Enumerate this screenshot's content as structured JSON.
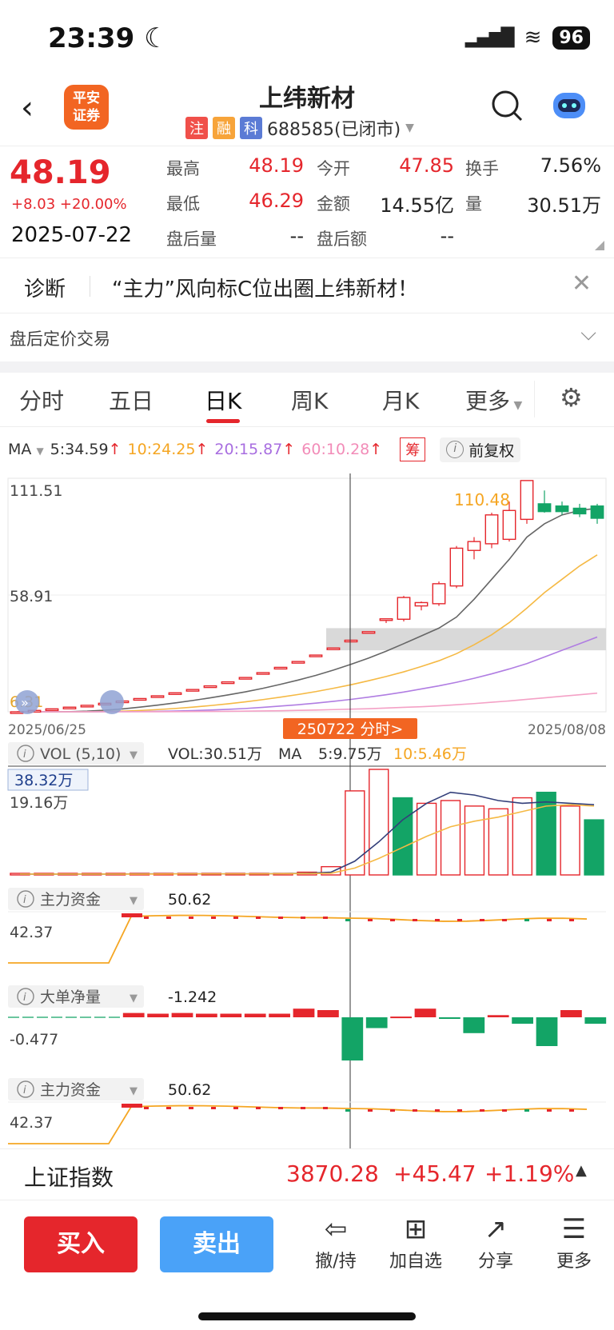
{
  "status": {
    "time": "23:39",
    "battery": "96"
  },
  "header": {
    "logo_line1": "平安",
    "logo_line2": "证券",
    "title": "上纬新材",
    "tags": [
      {
        "label": "注",
        "color": "#f0504a"
      },
      {
        "label": "融",
        "color": "#f7a43a"
      },
      {
        "label": "科",
        "color": "#5b7bd5"
      }
    ],
    "code": "688585(已闭市)"
  },
  "quote": {
    "price": "48.19",
    "change": "+8.03 +20.00%",
    "date": "2025-07-22",
    "fields": [
      {
        "label": "最高",
        "value": "48.19",
        "color": "red"
      },
      {
        "label": "今开",
        "value": "47.85",
        "color": "red"
      },
      {
        "label": "换手",
        "value": "7.56%",
        "color": "black"
      },
      {
        "label": "最低",
        "value": "46.29",
        "color": "red"
      },
      {
        "label": "金额",
        "value": "14.55亿",
        "color": "black"
      },
      {
        "label": "量",
        "value": "30.51万",
        "color": "black"
      },
      {
        "label": "盘后量",
        "value": "--",
        "color": "black"
      },
      {
        "label": "盘后额",
        "value": "--",
        "color": "black"
      }
    ]
  },
  "diagnosis": {
    "label": "诊断",
    "text": "“主力”风向标C位出圈上纬新材！"
  },
  "post_trading": {
    "label": "盘后定价交易"
  },
  "tabs": [
    {
      "label": "分时",
      "active": false
    },
    {
      "label": "五日",
      "active": false
    },
    {
      "label": "日K",
      "active": true
    },
    {
      "label": "周K",
      "active": false
    },
    {
      "label": "月K",
      "active": false
    },
    {
      "label": "更多",
      "active": false
    }
  ],
  "ma": {
    "label": "MA",
    "items": [
      {
        "text": "5:34.59",
        "color": "#333333"
      },
      {
        "text": "10:24.25",
        "color": "#f5a623"
      },
      {
        "text": "20:15.87",
        "color": "#a86ee0"
      },
      {
        "text": "60:10.28",
        "color": "#f28cb8"
      }
    ],
    "chip_label": "筹",
    "fq_label": "前复权"
  },
  "chart_data": {
    "type": "candlestick",
    "y_labels": [
      "111.51",
      "58.91",
      "6.31"
    ],
    "ylim": [
      6.31,
      111.51
    ],
    "x_start": "2025/06/25",
    "x_end": "2025/08/08",
    "max_label": "110.48",
    "crosshair_label": "250722 分时>",
    "candles": [
      [
        6.31,
        6.31,
        6.31,
        6.31
      ],
      [
        6.94,
        6.94,
        6.94,
        6.94
      ],
      [
        7.63,
        7.63,
        7.63,
        7.63
      ],
      [
        8.39,
        8.39,
        8.39,
        8.39
      ],
      [
        9.23,
        9.23,
        9.23,
        9.23
      ],
      [
        10.15,
        10.15,
        10.15,
        10.15
      ],
      [
        11.17,
        11.17,
        11.17,
        11.17
      ],
      [
        12.28,
        12.28,
        12.28,
        12.28
      ],
      [
        13.51,
        13.51,
        13.51,
        13.51
      ],
      [
        14.86,
        14.86,
        14.86,
        14.86
      ],
      [
        16.35,
        16.35,
        16.35,
        16.35
      ],
      [
        17.98,
        17.98,
        17.98,
        17.98
      ],
      [
        19.78,
        19.78,
        19.78,
        19.78
      ],
      [
        21.76,
        21.76,
        21.76,
        21.76
      ],
      [
        23.94,
        23.94,
        23.94,
        23.94
      ],
      [
        26.33,
        26.33,
        26.33,
        26.33
      ],
      [
        28.96,
        28.96,
        28.96,
        28.96
      ],
      [
        31.86,
        31.86,
        31.86,
        31.86
      ],
      [
        35.05,
        35.05,
        35.05,
        35.05
      ],
      [
        38.55,
        38.55,
        38.55,
        38.55
      ],
      [
        42.41,
        42.41,
        42.41,
        42.41
      ],
      [
        47.85,
        48.19,
        46.29,
        48.19
      ],
      [
        48.0,
        58.5,
        47.0,
        57.8
      ],
      [
        54.0,
        56.0,
        52.0,
        55.5
      ],
      [
        55.0,
        65.0,
        54.0,
        64.0
      ],
      [
        63.0,
        81.0,
        62.0,
        80.0
      ],
      [
        79.0,
        85.0,
        75.0,
        83.0
      ],
      [
        82.0,
        96.0,
        80.0,
        95.0
      ],
      [
        84.0,
        101.0,
        83.0,
        97.0
      ],
      [
        93.0,
        110.48,
        91.0,
        110.48
      ],
      [
        100.0,
        106.0,
        96.0,
        96.5
      ],
      [
        99.0,
        101.0,
        95.0,
        96.5
      ],
      [
        98.0,
        100.0,
        94.0,
        95.5
      ],
      [
        99.0,
        100.0,
        91.0,
        93.5
      ]
    ],
    "ma_lines": [
      {
        "name": "MA5",
        "color": "#666666",
        "values": [
          6.31,
          6.31,
          6.31,
          6.4,
          6.6,
          7.0,
          7.6,
          8.4,
          9.3,
          10.3,
          11.4,
          12.6,
          13.9,
          15.3,
          16.9,
          18.7,
          20.6,
          22.7,
          25.1,
          27.7,
          30.5,
          33.6,
          37.0,
          40.5,
          44.0,
          49.0,
          57.0,
          66.0,
          75.0,
          85.0,
          91.0,
          95.0,
          97.0,
          98.0
        ]
      },
      {
        "name": "MA10",
        "color": "#f5b944",
        "values": [
          6.31,
          6.31,
          6.31,
          6.31,
          6.35,
          6.45,
          6.6,
          6.9,
          7.3,
          7.8,
          8.4,
          9.1,
          9.9,
          10.8,
          11.8,
          12.9,
          14.1,
          15.4,
          16.9,
          18.5,
          20.3,
          22.2,
          24.3,
          26.7,
          29.3,
          32.5,
          36.5,
          41.0,
          46.5,
          53.0,
          60.0,
          66.0,
          72.0,
          77.0
        ]
      },
      {
        "name": "MA20",
        "color": "#b07de2",
        "values": [
          6.31,
          6.31,
          6.31,
          6.31,
          6.31,
          6.33,
          6.36,
          6.4,
          6.5,
          6.65,
          6.85,
          7.1,
          7.4,
          7.8,
          8.3,
          8.9,
          9.5,
          10.2,
          11.0,
          11.9,
          12.9,
          14.0,
          15.2,
          16.6,
          18.0,
          19.6,
          21.4,
          23.4,
          25.6,
          28.0,
          31.0,
          34.0,
          37.0,
          40.0
        ]
      },
      {
        "name": "MA60",
        "color": "#f4a1c6",
        "values": [
          6.31,
          6.31,
          6.31,
          6.31,
          6.31,
          6.31,
          6.32,
          6.33,
          6.35,
          6.38,
          6.42,
          6.47,
          6.53,
          6.6,
          6.7,
          6.8,
          6.95,
          7.1,
          7.3,
          7.5,
          7.7,
          8.0,
          8.3,
          8.6,
          9.0,
          9.5,
          10.0,
          10.6,
          11.2,
          11.9,
          12.6,
          13.3,
          14.0,
          14.7
        ]
      }
    ],
    "vol": {
      "label": "VOL (5,10)",
      "vol_text": "VOL:30.51万",
      "ma_label": "MA",
      "ma5": "5:9.75万",
      "ma10": "10:5.46万",
      "top_label": "38.32万",
      "mid_label": "19.16万",
      "values": [
        0.3,
        0.3,
        0.3,
        0.4,
        0.5,
        0.5,
        0.4,
        0.4,
        0.4,
        0.4,
        0.5,
        0.5,
        1.0,
        3.0,
        30.51,
        38.32,
        28.0,
        26.0,
        27.0,
        25.0,
        24.0,
        28.0,
        30.0,
        25.0,
        20.0
      ],
      "colors": [
        "r",
        "r",
        "r",
        "r",
        "r",
        "r",
        "r",
        "r",
        "r",
        "r",
        "r",
        "r",
        "r",
        "r",
        "r",
        "r",
        "g",
        "r",
        "r",
        "r",
        "r",
        "r",
        "g",
        "r",
        "g"
      ]
    },
    "fund1": {
      "label": "主力资金",
      "value": "50.62",
      "ylabel": "42.37"
    },
    "bigorder": {
      "label": "大单净量",
      "value": "-1.242",
      "ylabel": "-0.477"
    },
    "fund2": {
      "label": "主力资金",
      "value": "50.62",
      "ylabel": "42.37"
    }
  },
  "index_bar": {
    "name": "上证指数",
    "value": "3870.28",
    "change": "+45.47",
    "pct": "+1.19%"
  },
  "actions": {
    "buy": "买入",
    "sell": "卖出",
    "items": [
      {
        "label": "撤/持",
        "icon": "withdraw-icon",
        "glyph": "⇦"
      },
      {
        "label": "加自选",
        "icon": "add-watchlist-icon",
        "glyph": "⊞"
      },
      {
        "label": "分享",
        "icon": "share-icon",
        "glyph": "↗"
      },
      {
        "label": "更多",
        "icon": "more-icon",
        "glyph": "☰"
      }
    ]
  }
}
